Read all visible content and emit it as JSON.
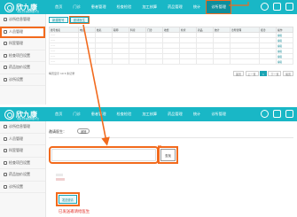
{
  "app": {
    "brand": "欣九康",
    "brand_sub": "中国卫生健康网络平台"
  },
  "nav": [
    "首页",
    "门诊",
    "患者管理",
    "检查检验",
    "加工核算",
    "药品管理",
    "统计",
    "诊所管理"
  ],
  "sidebar": [
    "诊所信息管理",
    "人员管理",
    "科室管理",
    "检查项目设置",
    "药品加价设置",
    "诊所设置"
  ],
  "list_view": {
    "buttons": [
      "新建账号",
      "邀请医生"
    ],
    "columns": [
      "账号姓名",
      "电话",
      "姓名",
      "职称",
      "科室",
      "门诊",
      "收费",
      "检查",
      "药品",
      "统计",
      "诊所管理",
      "拒诊",
      "操作"
    ],
    "rows": [
      {
        "name": "——",
        "action": "编辑"
      },
      {
        "name": "——",
        "action": "编辑"
      },
      {
        "name": "——",
        "action": "编辑"
      },
      {
        "name": "——",
        "action": "编辑"
      },
      {
        "name": "——",
        "action": "编辑"
      },
      {
        "name": "——",
        "action": "编辑"
      }
    ],
    "pager": {
      "info": "每页显示 10 ▾ 条记录",
      "buttons": [
        "首页",
        "上一页",
        "1",
        "下一页",
        "尾页"
      ],
      "current": "1"
    }
  },
  "invite_view": {
    "label": "邀请医生：",
    "tag": "返回",
    "search_placeholder": "",
    "search_button": "查找",
    "invite_button": "发送邀请",
    "note": "已发送邀请给医生"
  },
  "colors": {
    "primary": "#19b7c6",
    "highlight": "#f26a1d",
    "note": "#e0322b"
  }
}
